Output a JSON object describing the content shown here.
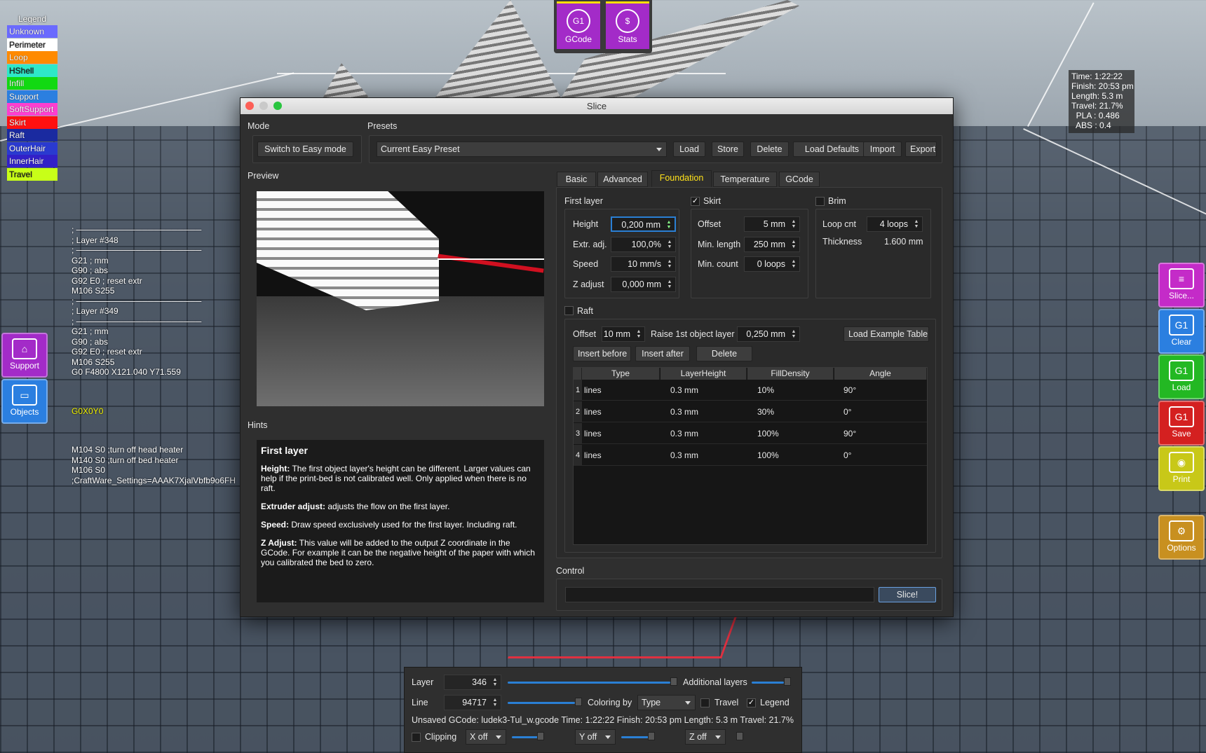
{
  "legend": {
    "title": "Legend",
    "items": [
      {
        "label": "Unknown",
        "color": "#6a6aff"
      },
      {
        "label": "Perimeter",
        "color": "#ffffff"
      },
      {
        "label": "Loop",
        "color": "#ff8a00"
      },
      {
        "label": "HShell",
        "color": "#2ee8c8"
      },
      {
        "label": "Infill",
        "color": "#12d912"
      },
      {
        "label": "Support",
        "color": "#2b7fe0"
      },
      {
        "label": "SoftSupport",
        "color": "#ff3fd0"
      },
      {
        "label": "Skirt",
        "color": "#ff1010"
      },
      {
        "label": "Raft",
        "color": "#1a2aa0"
      },
      {
        "label": "OuterHair",
        "color": "#2a3ad0"
      },
      {
        "label": "InnerHair",
        "color": "#3220c8"
      },
      {
        "label": "Travel",
        "color": "#c8ff18"
      }
    ]
  },
  "gcode": {
    "lines": [
      "; ─────────────────────",
      "; Layer #348",
      "; ─────────────────────",
      "G21 ; mm",
      "G90 ; abs",
      "G92 E0 ; reset extr",
      "M106 S255",
      "; ─────────────────────",
      "; Layer #349",
      "; ─────────────────────",
      "G21 ; mm",
      "G90 ; abs",
      "G92 E0 ; reset extr",
      "M106 S255",
      "G0 F4800 X121.040 Y71.559"
    ],
    "highlight": "G0X0Y0",
    "tail": [
      "M104 S0 ;turn off head heater",
      "M140 S0 ;turn off bed heater",
      "M106 S0",
      ";CraftWare_Settings=AAAK7XjalVbfb9o6FH"
    ]
  },
  "top": {
    "gcode_label": "GCode",
    "stats_label": "Stats",
    "gcode_icon": "G1",
    "stats_icon": "$"
  },
  "stats": {
    "lines": [
      "Time: 1:22:22",
      "Finish: 20:53 pm",
      "Length: 5.3 m",
      "Travel: 21.7%",
      "  PLA : 0.486",
      "  ABS : 0.4"
    ]
  },
  "left_buttons": [
    {
      "label": "Support",
      "color": "#a32bc8"
    },
    {
      "label": "Objects",
      "color": "#2b7fe0"
    }
  ],
  "right_buttons": [
    {
      "label": "Slice...",
      "color": "#c42bc8"
    },
    {
      "label": "Clear",
      "color": "#2b7fe0"
    },
    {
      "label": "Load",
      "color": "#23b823"
    },
    {
      "label": "Save",
      "color": "#d42020"
    },
    {
      "label": "Print",
      "color": "#c8c818"
    },
    {
      "label": "Options",
      "color": "#c89020"
    }
  ],
  "dialog": {
    "title": "Slice",
    "mode_label": "Mode",
    "presets_label": "Presets",
    "switch_mode": "Switch to Easy mode",
    "preset_value": "Current Easy Preset",
    "preset_buttons": [
      "Load",
      "Store",
      "Delete",
      "Load Defaults",
      "Import",
      "Export"
    ],
    "preview_label": "Preview",
    "hints_label": "Hints",
    "control_label": "Control",
    "tabs": [
      "Basic",
      "Advanced",
      "Foundation",
      "Temperature",
      "GCode"
    ],
    "active_tab": "Foundation",
    "first_layer": {
      "label": "First layer",
      "height_label": "Height",
      "height": "0,200 mm",
      "extr_label": "Extr. adj.",
      "extr": "100,0%",
      "speed_label": "Speed",
      "speed": "10 mm/s",
      "z_label": "Z adjust",
      "z": "0,000 mm"
    },
    "skirt": {
      "label": "Skirt",
      "checked": "✓",
      "offset_label": "Offset",
      "offset": "5 mm",
      "minlen_label": "Min. length",
      "minlen": "250 mm",
      "mincount_label": "Min. count",
      "mincount": "0 loops"
    },
    "brim": {
      "label": "Brim",
      "loop_label": "Loop cnt",
      "loop": "4 loops",
      "thick_label": "Thickness",
      "thick": "1.600 mm"
    },
    "raft": {
      "label": "Raft",
      "offset_label": "Offset",
      "offset": "10 mm",
      "raise_label": "Raise 1st object layer",
      "raise": "0,250 mm",
      "load_table": "Load Example Table",
      "insert_before": "Insert before",
      "insert_after": "Insert after",
      "delete": "Delete",
      "columns": [
        "Type",
        "LayerHeight",
        "FillDensity",
        "Angle"
      ],
      "rows": [
        [
          "1",
          "lines",
          "0.3 mm",
          "10%",
          "90°"
        ],
        [
          "2",
          "lines",
          "0.3 mm",
          "30%",
          "0°"
        ],
        [
          "3",
          "lines",
          "0.3 mm",
          "100%",
          "90°"
        ],
        [
          "4",
          "lines",
          "0.3 mm",
          "100%",
          "0°"
        ]
      ]
    },
    "hints": {
      "title": "First layer",
      "p1b": "Height:",
      "p1": " The first object layer's height can be different. Larger values can help if the print-bed is not calibrated well. Only applied when there is no raft.",
      "p2b": "Extruder adjust:",
      "p2": " adjusts the flow on the first layer.",
      "p3b": "Speed:",
      "p3": " Draw speed exclusively used for the first layer. Including raft.",
      "p4b": "Z Adjust:",
      "p4": " This value will be added to the output Z coordinate in the GCode. For example it can be the negative height of the paper with which you calibrated the bed to zero."
    },
    "slice_button": "Slice!"
  },
  "bottom": {
    "layer_label": "Layer",
    "layer": "346",
    "additional_layers": "Additional layers",
    "line_label": "Line",
    "line": "94717",
    "coloring_label": "Coloring by",
    "coloring": "Type",
    "travel_label": "Travel",
    "legend_label": "Legend",
    "legend_check": "✓",
    "status": "Unsaved GCode: ludek3-Tul_w.gcode  Time: 1:22:22  Finish: 20:53 pm  Length: 5.3 m  Travel: 21.7%",
    "clipping_label": "Clipping",
    "x": "X off",
    "y": "Y off",
    "z": "Z off"
  }
}
